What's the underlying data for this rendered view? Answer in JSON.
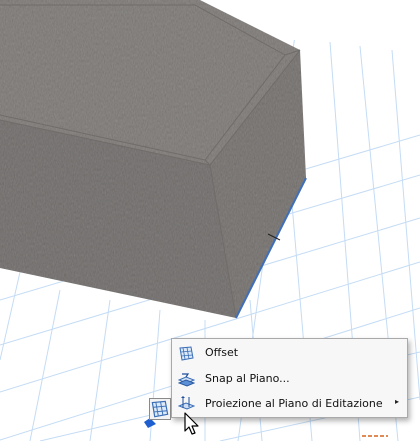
{
  "scene": {
    "background_color": "#ffffff",
    "grid_color": "#bcd7f3",
    "wall_texture_color": "#9a9795",
    "edge_highlight_color": "#3f6fb8"
  },
  "context_menu": {
    "items": [
      {
        "label": "Offset",
        "icon": "offset-icon"
      },
      {
        "label": "Snap al Piano...",
        "icon": "snap-plane-icon"
      },
      {
        "label": "Proiezione al Piano di Editazione",
        "icon": "projection-plane-icon",
        "has_submenu": true
      }
    ],
    "submenu_arrow": "▸"
  },
  "pet_palette": {
    "icon": "offset-icon",
    "accent_color": "#1d5fd0"
  },
  "cursor": {
    "icon": "pointer-cursor-icon"
  }
}
